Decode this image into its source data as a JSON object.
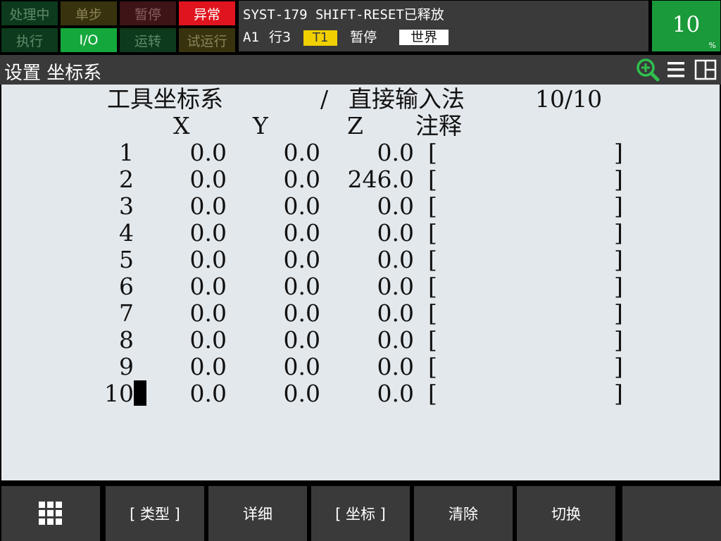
{
  "status_lamps": [
    {
      "label": "处理中",
      "bg": "#0d3a1c",
      "fg": "#5f8a6c"
    },
    {
      "label": "单步",
      "bg": "#38330e",
      "fg": "#8a8356"
    },
    {
      "label": "暂停",
      "bg": "#3e1416",
      "fg": "#8a5f62"
    },
    {
      "label": "异常",
      "bg": "#e0141e",
      "fg": "#ffffff"
    },
    {
      "label": "执行",
      "bg": "#0d3a1c",
      "fg": "#5f8a6c"
    },
    {
      "label": "I/O",
      "bg": "#14a83c",
      "fg": "#ffffff"
    },
    {
      "label": "运转",
      "bg": "#0d3a1c",
      "fg": "#5f8a6c"
    },
    {
      "label": "试运行",
      "bg": "#38330e",
      "fg": "#8a8356"
    }
  ],
  "message": {
    "line1": "SYST-179 SHIFT-RESET已释放",
    "group": "A1",
    "line": "行3",
    "mode_badge": "T1",
    "state": "暂停",
    "frame_badge": "世界"
  },
  "override": {
    "value": "10",
    "unit": "%"
  },
  "title_bar": {
    "title": "设置 坐标系"
  },
  "screen": {
    "heading": "工具坐标系",
    "separator": "/",
    "method": "直接输入法",
    "page": "10/10",
    "col_x": "X",
    "col_y": "Y",
    "col_z": "Z",
    "col_comment": "注释",
    "rows": [
      {
        "no": "1",
        "x": "0.0",
        "y": "0.0",
        "z": "0.0",
        "comment": ""
      },
      {
        "no": "2",
        "x": "0.0",
        "y": "0.0",
        "z": "246.0",
        "comment": ""
      },
      {
        "no": "3",
        "x": "0.0",
        "y": "0.0",
        "z": "0.0",
        "comment": ""
      },
      {
        "no": "4",
        "x": "0.0",
        "y": "0.0",
        "z": "0.0",
        "comment": ""
      },
      {
        "no": "5",
        "x": "0.0",
        "y": "0.0",
        "z": "0.0",
        "comment": ""
      },
      {
        "no": "6",
        "x": "0.0",
        "y": "0.0",
        "z": "0.0",
        "comment": ""
      },
      {
        "no": "7",
        "x": "0.0",
        "y": "0.0",
        "z": "0.0",
        "comment": ""
      },
      {
        "no": "8",
        "x": "0.0",
        "y": "0.0",
        "z": "0.0",
        "comment": ""
      },
      {
        "no": "9",
        "x": "0.0",
        "y": "0.0",
        "z": "0.0",
        "comment": ""
      },
      {
        "no": "10",
        "x": "0.0",
        "y": "0.0",
        "z": "0.0",
        "comment": ""
      }
    ],
    "bracket_open": "[",
    "bracket_close": "]"
  },
  "function_keys": [
    "",
    "[ 类型 ]",
    "详细",
    "[ 坐标 ]",
    "清除",
    "切换",
    ""
  ],
  "colors": {
    "accent_green": "#1a9a3a",
    "alarm_red": "#e0141e",
    "t1_yellow": "#f0d000",
    "content_bg": "#e3e8ec"
  }
}
